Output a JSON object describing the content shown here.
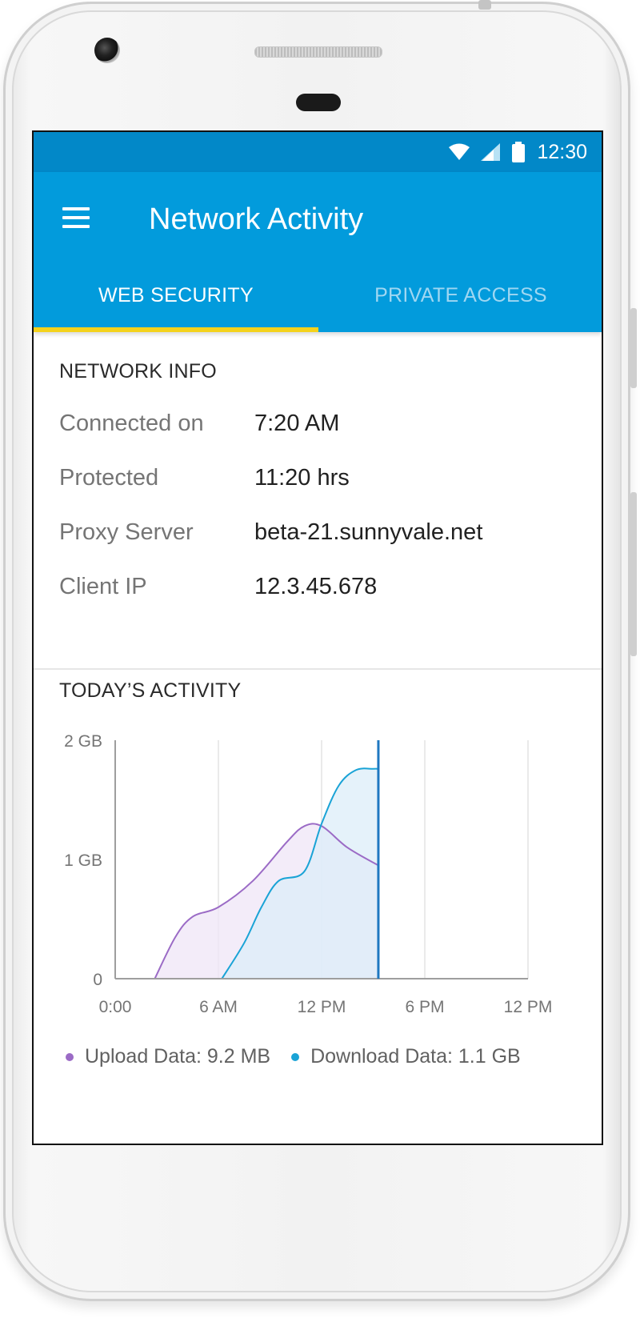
{
  "status_bar": {
    "time": "12:30",
    "icons": [
      "wifi-icon",
      "cell-signal-icon",
      "battery-icon"
    ]
  },
  "app_bar": {
    "title": "Network Activity",
    "menu_icon": "hamburger-menu-icon",
    "color": "#029bdc",
    "status_color": "#0288c8"
  },
  "tabs": [
    {
      "label": "WEB SECURITY",
      "active": true
    },
    {
      "label": "PRIVATE ACCESS",
      "active": false
    }
  ],
  "tab_indicator_color": "#f4d21c",
  "network_info": {
    "title": "NETWORK INFO",
    "rows": [
      {
        "label": "Connected on",
        "value": "7:20 AM"
      },
      {
        "label": "Protected",
        "value": "11:20 hrs"
      },
      {
        "label": "Proxy Server",
        "value": "beta-21.sunnyvale.net"
      },
      {
        "label": "Client IP",
        "value": "12.3.45.678"
      }
    ]
  },
  "activity": {
    "title": "TODAY’S ACTIVITY",
    "legend": [
      {
        "label": "Upload Data: 9.2 MB",
        "color": "#9b6bc6"
      },
      {
        "label": "Download Data: 1.1 GB",
        "color": "#1aa3d6"
      }
    ]
  },
  "chart_data": {
    "type": "area",
    "x_unit": "hours",
    "x_ticks": [
      0,
      6,
      12,
      18,
      24
    ],
    "x_tick_labels": [
      "0:00",
      "6 AM",
      "12 PM",
      "6 PM",
      "12 PM"
    ],
    "y_ticks": [
      0,
      1,
      2
    ],
    "y_tick_labels": [
      "0",
      "1 GB",
      "2 GB"
    ],
    "ylim": [
      0,
      2
    ],
    "xlim": [
      0,
      24
    ],
    "current_time_marker": 15.3,
    "grid": true,
    "series": [
      {
        "name": "Upload Data",
        "color": "#9b6bc6",
        "fill": "#efe6f7",
        "x": [
          2.3,
          3.5,
          4.5,
          6.0,
          8.0,
          10.0,
          11.0,
          12.0,
          13.5,
          15.3
        ],
        "y": [
          0.0,
          0.35,
          0.52,
          0.6,
          0.82,
          1.15,
          1.28,
          1.28,
          1.1,
          0.95
        ]
      },
      {
        "name": "Download Data",
        "color": "#1aa3d6",
        "fill": "#dcedf8",
        "x": [
          6.2,
          7.5,
          8.5,
          9.5,
          11.0,
          12.0,
          13.0,
          14.0,
          15.0,
          15.3
        ],
        "y": [
          0.0,
          0.3,
          0.6,
          0.82,
          0.9,
          1.3,
          1.62,
          1.75,
          1.76,
          1.76
        ]
      }
    ]
  }
}
